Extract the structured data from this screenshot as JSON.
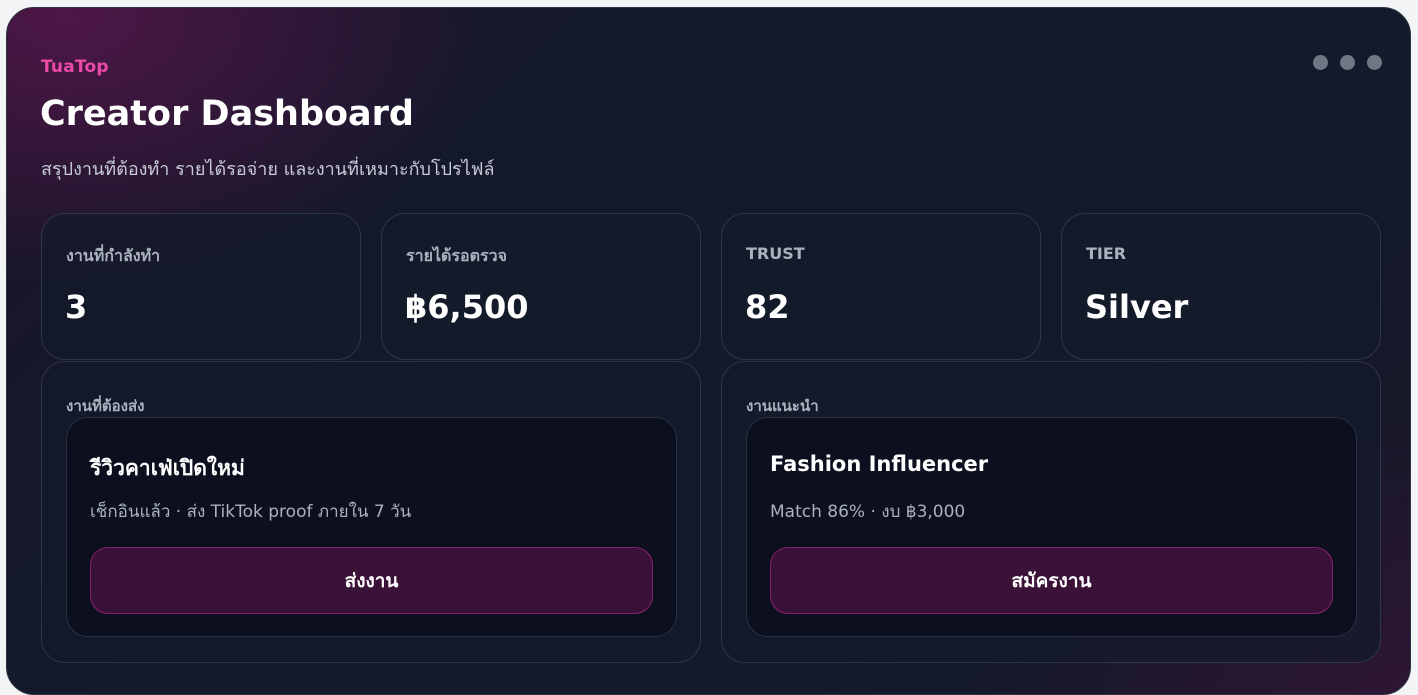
{
  "header": {
    "brand": "TuaTop",
    "title": "Creator Dashboard",
    "subtitle": "สรุปงานที่ต้องทำ รายได้รอจ่าย และงานที่เหมาะกับโปรไฟล์",
    "menu_icon": "more-dots-icon"
  },
  "stats": [
    {
      "label": "งานที่กำลังทำ",
      "value": "3"
    },
    {
      "label": "รายได้รอตรวจ",
      "value": "฿6,500"
    },
    {
      "label": "TRUST",
      "value": "82"
    },
    {
      "label": "TIER",
      "value": "Silver"
    }
  ],
  "tasks": {
    "label": "งานที่ต้องส่ง",
    "item": {
      "title": "รีวิวคาเฟ่เปิดใหม่",
      "meta": "เช็กอินแล้ว · ส่ง TikTok proof ภายใน 7 วัน",
      "action": "ส่งงาน"
    }
  },
  "recommended": {
    "label": "งานแนะนำ",
    "item": {
      "title": "Fashion Influencer",
      "meta": "Match 86% · งบ ฿3,000",
      "action": "สมัครงาน"
    }
  },
  "colors": {
    "accent": "#ec4aa8",
    "button_bg": "#3a1238",
    "button_border": "#8a1f6e",
    "card_border": "#2e3648"
  }
}
